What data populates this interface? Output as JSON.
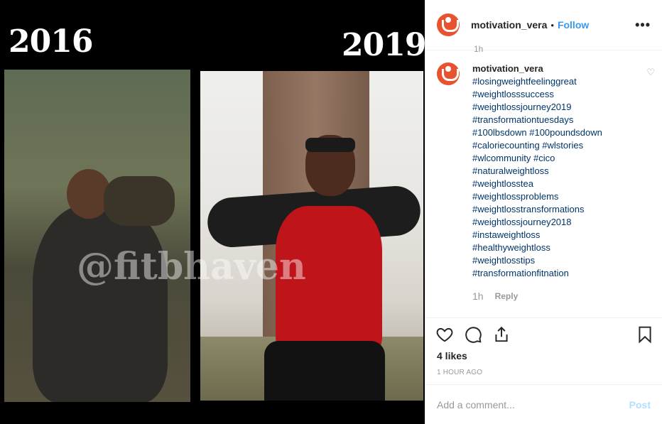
{
  "image": {
    "year_left": "2016",
    "year_right": "2019",
    "watermark": "@fitbhaven"
  },
  "header": {
    "username": "motivation_vera",
    "separator": "•",
    "follow_label": "Follow",
    "more_label": "•••"
  },
  "scroll_stub": "1h",
  "comment": {
    "username": "motivation_vera",
    "hashtags": [
      "#losingweightfeelinggreat",
      "#weightlosssuccess",
      "#weightlossjourney2019",
      "#transformationtuesdays",
      "#100lbsdown #100poundsdown",
      "#caloriecounting #wlstories",
      "#wlcommunity #cico",
      "#naturalweightloss",
      "#weightlosstea",
      "#weightlossproblems",
      "#weightlosstransformations",
      "#weightlossjourney2018",
      "#instaweightloss",
      "#healthyweightloss",
      "#weightlosstips",
      "#transformationfitnation"
    ],
    "time": "1h",
    "reply_label": "Reply"
  },
  "actions": {
    "like_icon": "heart-icon",
    "comment_icon": "comment-icon",
    "share_icon": "share-icon",
    "save_icon": "bookmark-icon"
  },
  "likes": "4 likes",
  "timestamp": "1 HOUR AGO",
  "add_comment": {
    "placeholder": "Add a comment...",
    "post_label": "Post"
  },
  "colors": {
    "link_blue": "#3897f0",
    "hashtag": "#003569",
    "avatar": "#e7532f",
    "post_disabled": "#b2dffc"
  }
}
